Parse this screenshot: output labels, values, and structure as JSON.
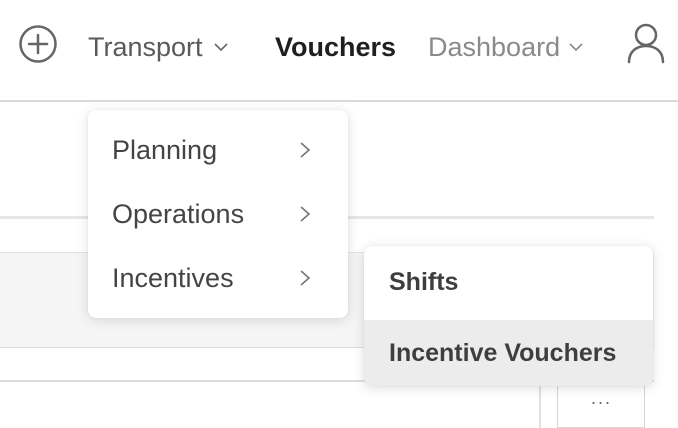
{
  "nav": {
    "transport_label": "Transport",
    "vouchers_label": "Vouchers",
    "dashboard_label": "Dashboard"
  },
  "transport_menu": {
    "items": [
      {
        "label": "Planning"
      },
      {
        "label": "Operations"
      },
      {
        "label": "Incentives"
      }
    ]
  },
  "incentives_submenu": {
    "items": [
      {
        "label": "Shifts"
      },
      {
        "label": "Incentive Vouchers",
        "highlighted": true
      }
    ]
  },
  "background": {
    "more_button_label": "···"
  },
  "icons": {
    "add": "plus-circle-icon",
    "user": "user-icon",
    "chevron": "chevron-down-icon",
    "submenu": "chevron-right-icon"
  },
  "colors": {
    "active_nav": "#1f1f1f",
    "nav_text": "#5a5a5a",
    "muted_nav": "#8a8a8a",
    "highlight_bg": "#ececed"
  }
}
